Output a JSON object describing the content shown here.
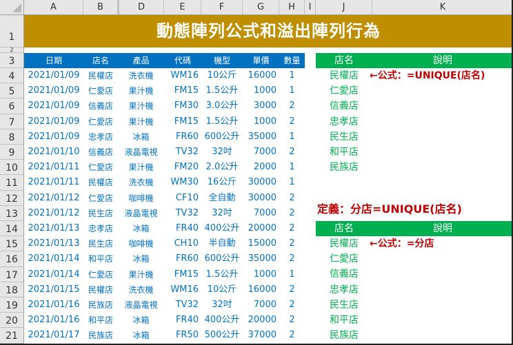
{
  "sheet": {
    "column_headers": [
      "A",
      "B",
      "D",
      "E",
      "F",
      "G",
      "H",
      "I",
      "J",
      "K"
    ],
    "row_numbers": [
      "1",
      "2",
      "3",
      "4",
      "5",
      "6",
      "7",
      "8",
      "9",
      "10",
      "11",
      "12",
      "13",
      "14",
      "15",
      "16",
      "17",
      "18",
      "19",
      "20",
      "21"
    ],
    "title": "動態陣列公式和溢出陣列行為"
  },
  "colors": {
    "title_bg": "#bf8f00",
    "table_header_bg": "#0070c0",
    "table_text": "#0070c0",
    "result_header_bg": "#00b050",
    "result_text": "#00b050",
    "note_text": "#c00000"
  },
  "table": {
    "headers": [
      "日期",
      "店名",
      "產品",
      "代碼",
      "機型",
      "單價",
      "數量"
    ],
    "rows": [
      [
        "2021/01/09",
        "民權店",
        "洗衣機",
        "WM16",
        "10公斤",
        "16000",
        "1"
      ],
      [
        "2021/01/09",
        "仁愛店",
        "果汁機",
        "FM15",
        "1.5公升",
        "1000",
        "1"
      ],
      [
        "2021/01/09",
        "信義店",
        "果汁機",
        "FM30",
        "3.0公升",
        "3000",
        "2"
      ],
      [
        "2021/01/09",
        "仁愛店",
        "果汁機",
        "FM15",
        "1.5公升",
        "1000",
        "2"
      ],
      [
        "2021/01/09",
        "忠孝店",
        "冰箱",
        "FR60",
        "600公升",
        "35000",
        "1"
      ],
      [
        "2021/01/10",
        "信義店",
        "液晶電視",
        "TV32",
        "32吋",
        "7000",
        "2"
      ],
      [
        "2021/01/11",
        "仁愛店",
        "果汁機",
        "FM20",
        "2.0公升",
        "2000",
        "1"
      ],
      [
        "2021/01/11",
        "民權店",
        "洗衣機",
        "WM30",
        "16公斤",
        "30000",
        "1"
      ],
      [
        "2021/01/12",
        "仁愛店",
        "咖啡機",
        "CF10",
        "全自動",
        "30000",
        "2"
      ],
      [
        "2021/01/12",
        "民生店",
        "液晶電視",
        "TV32",
        "32吋",
        "7000",
        "2"
      ],
      [
        "2021/01/13",
        "忠孝店",
        "冰箱",
        "FR40",
        "400公升",
        "20000",
        "2"
      ],
      [
        "2021/01/13",
        "民生店",
        "咖啡機",
        "CH10",
        "半自動",
        "15000",
        "2"
      ],
      [
        "2021/01/14",
        "和平店",
        "冰箱",
        "FR60",
        "600公升",
        "35000",
        "2"
      ],
      [
        "2021/01/14",
        "仁愛店",
        "果汁機",
        "FM15",
        "1.5公升",
        "1000",
        "1"
      ],
      [
        "2021/01/15",
        "民權店",
        "洗衣機",
        "WM16",
        "10公斤",
        "16000",
        "2"
      ],
      [
        "2021/01/16",
        "民族店",
        "液晶電視",
        "TV32",
        "32吋",
        "7000",
        "2"
      ],
      [
        "2021/01/16",
        "和平店",
        "冰箱",
        "FR40",
        "400公升",
        "20000",
        "2"
      ],
      [
        "2021/01/17",
        "民族店",
        "冰箱",
        "FR50",
        "500公升",
        "37000",
        "2"
      ]
    ]
  },
  "result1": {
    "headers": [
      "店名",
      "說明"
    ],
    "stores": [
      "民權店",
      "仁愛店",
      "信義店",
      "忠孝店",
      "民生店",
      "和平店",
      "民族店"
    ],
    "note": "←公式：=UNIQUE(店名)"
  },
  "definition": "定義：分店=UNIQUE(店名)",
  "result2": {
    "headers": [
      "店名",
      "說明"
    ],
    "stores": [
      "民權店",
      "仁愛店",
      "信義店",
      "忠孝店",
      "民生店",
      "和平店",
      "民族店"
    ],
    "note": "←公式：=分店"
  }
}
